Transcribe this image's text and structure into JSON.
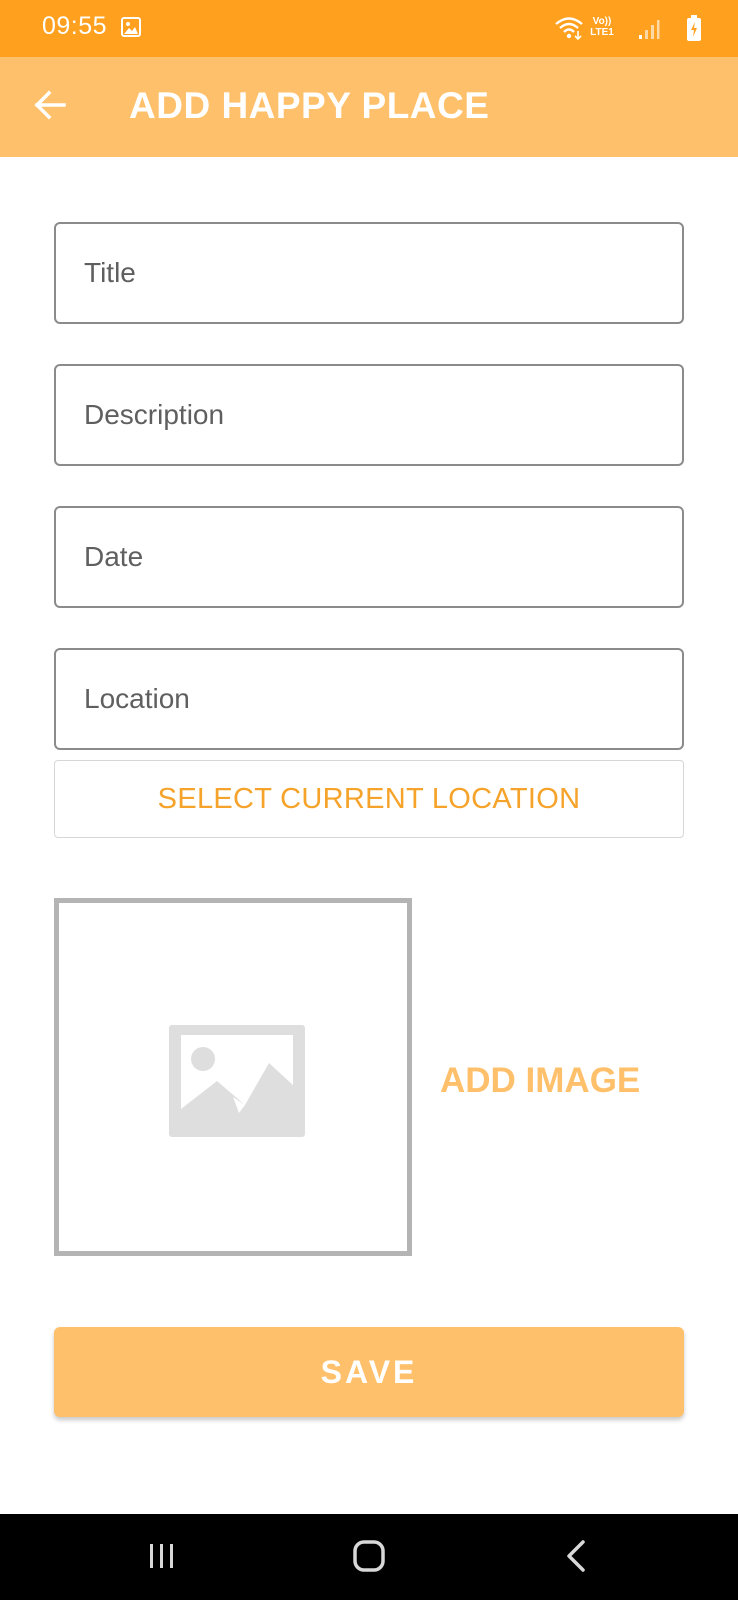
{
  "status_bar": {
    "time": "09:55",
    "network_label_top": "Vo))",
    "network_label_bottom": "LTE1",
    "icons": [
      "photo-icon",
      "wifi-icon",
      "signal-icon",
      "battery-charging-icon"
    ]
  },
  "app_bar": {
    "title": "ADD HAPPY PLACE",
    "back_icon": "arrow-left-icon"
  },
  "form": {
    "title_placeholder": "Title",
    "title_value": "",
    "description_placeholder": "Description",
    "description_value": "",
    "date_placeholder": "Date",
    "date_value": "",
    "location_placeholder": "Location",
    "location_value": "",
    "select_location_label": "SELECT CURRENT LOCATION",
    "add_image_label": "ADD IMAGE",
    "save_label": "SAVE"
  },
  "colors": {
    "status_bar": "#ffa01e",
    "app_bar": "#ffc06b",
    "accent_text": "#f5a32a",
    "add_image_text": "#ffc06b",
    "save_button": "#ffc06b"
  },
  "nav_bar": {
    "icons": [
      "recents-icon",
      "home-icon",
      "back-icon"
    ]
  }
}
